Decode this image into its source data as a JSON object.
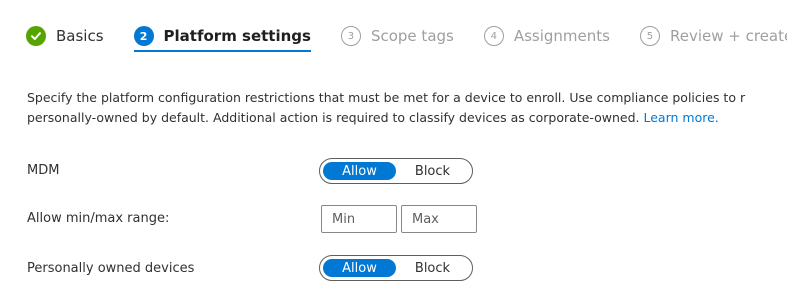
{
  "steps": [
    {
      "label": "Basics",
      "state": "done"
    },
    {
      "label": "Platform settings",
      "state": "active",
      "number": "2"
    },
    {
      "label": "Scope tags",
      "state": "pending",
      "number": "3"
    },
    {
      "label": "Assignments",
      "state": "pending",
      "number": "4"
    },
    {
      "label": "Review + create",
      "state": "pending",
      "number": "5"
    }
  ],
  "description": {
    "line1": "Specify the platform configuration restrictions that must be met for a device to enroll. Use compliance policies to r",
    "line2": "personally-owned by default. Additional action is required to classify devices as corporate-owned.",
    "link": "Learn more."
  },
  "mdm": {
    "label": "MDM",
    "allow": "Allow",
    "block": "Block",
    "selected": "Allow"
  },
  "range": {
    "label": "Allow min/max range:",
    "min_placeholder": "Min",
    "max_placeholder": "Max"
  },
  "personal": {
    "label": "Personally owned devices",
    "allow": "Allow",
    "block": "Block",
    "selected": "Allow"
  },
  "colors": {
    "accent": "#0078d4",
    "done": "#57a300",
    "pending": "#a19f9d"
  }
}
